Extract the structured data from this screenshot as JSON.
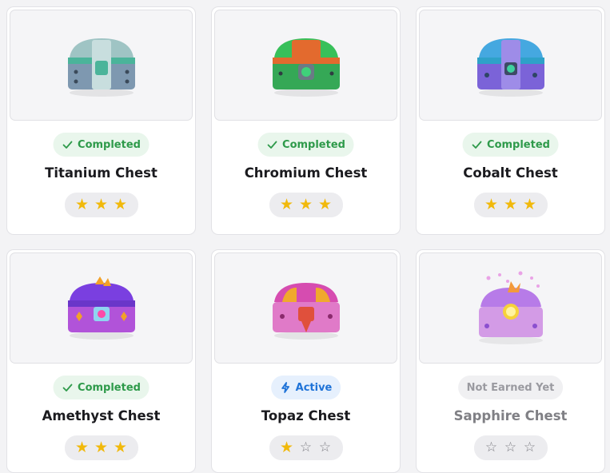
{
  "chests": [
    {
      "name": "Titanium Chest",
      "status": "Completed",
      "status_type": "completed",
      "stars_earned": 3,
      "stars_total": 3,
      "theme_colors": [
        "#9fc4c4",
        "#7e98b0",
        "#4bb49a"
      ]
    },
    {
      "name": "Chromium Chest",
      "status": "Completed",
      "status_type": "completed",
      "stars_earned": 3,
      "stars_total": 3,
      "theme_colors": [
        "#38c05a",
        "#e36a2e",
        "#35a856"
      ]
    },
    {
      "name": "Cobalt Chest",
      "status": "Completed",
      "status_type": "completed",
      "stars_earned": 3,
      "stars_total": 3,
      "theme_colors": [
        "#45a8e0",
        "#7b63d8",
        "#2ea1c8"
      ]
    },
    {
      "name": "Amethyst Chest",
      "status": "Completed",
      "status_type": "completed",
      "stars_earned": 3,
      "stars_total": 3,
      "theme_colors": [
        "#7a3fe0",
        "#b153d9",
        "#f2a129"
      ]
    },
    {
      "name": "Topaz Chest",
      "status": "Active",
      "status_type": "active",
      "stars_earned": 1,
      "stars_total": 3,
      "theme_colors": [
        "#d64cb0",
        "#f0a92d",
        "#e0503c"
      ]
    },
    {
      "name": "Sapphire Chest",
      "status": "Not Earned Yet",
      "status_type": "pending",
      "stars_earned": 0,
      "stars_total": 3,
      "theme_colors": [
        "#b77be8",
        "#e9a3e6",
        "#f6d23a"
      ]
    }
  ],
  "colors": {
    "completed": "#2e9a4a",
    "active": "#1f73d8",
    "pending": "#9a9aa0",
    "star": "#f1b90b"
  },
  "icons": {
    "completed": "check-icon",
    "active": "lightning-icon"
  }
}
